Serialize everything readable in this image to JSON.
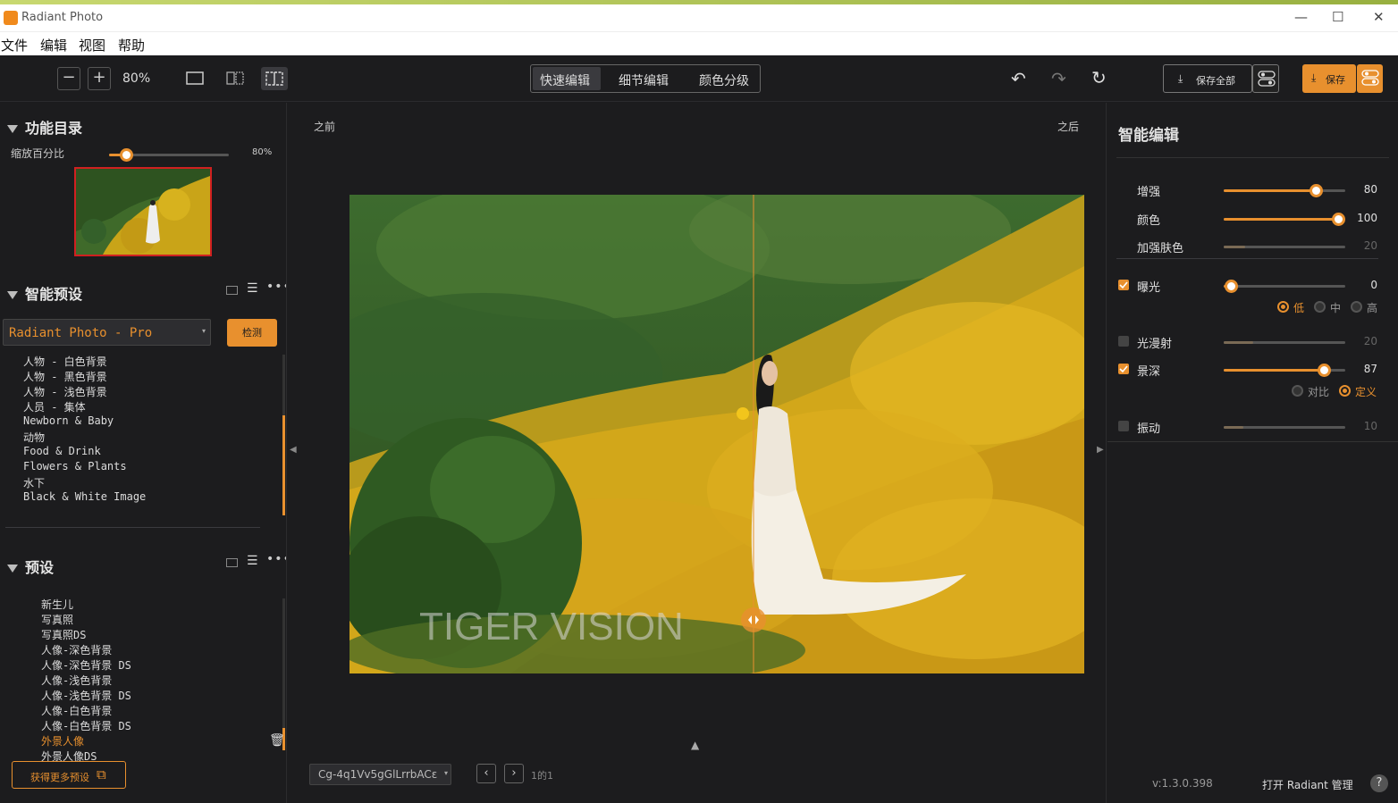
{
  "window": {
    "title": "Radiant Photo",
    "minimize": "—",
    "maximize": "☐",
    "close": "✕"
  },
  "menu": [
    "文件",
    "编辑",
    "视图",
    "帮助"
  ],
  "toolbar": {
    "zoom_out": "−",
    "zoom_in": "+",
    "zoom": "80%",
    "modes": [
      "快速编辑",
      "细节编辑",
      "颜色分级"
    ],
    "save_all": "保存全部",
    "save": "保存"
  },
  "left": {
    "catalog_title": "功能目录",
    "zoom_label": "缩放百分比",
    "zoom_value": "80%",
    "zoom_fraction": 0.14,
    "smart_presets_title": "智能预设",
    "preset_select": "Radiant Photo - Pro",
    "detect_label": "检测",
    "smart_presets": [
      "人物 - 白色背景",
      "人物 - 黑色背景",
      "人物 - 浅色背景",
      "人员 - 集体",
      "Newborn & Baby",
      "动物",
      "Food & Drink",
      "Flowers & Plants",
      "水下",
      "Black & White Image"
    ],
    "presets_title": "预设",
    "presets": [
      "新生儿",
      "写真照",
      "写真照DS",
      "人像-深色背景",
      "人像-深色背景 DS",
      "人像-浅色背景",
      "人像-浅色背景 DS",
      "人像-白色背景",
      "人像-白色背景 DS",
      "外景人像",
      "外景人像DS"
    ],
    "active_preset": "外景人像",
    "more_presets": "获得更多预设"
  },
  "center": {
    "before": "之前",
    "after": "之后",
    "watermark": "TIGER VISION",
    "file_select": "Cg-4q1Vv5gGlLrrbACε",
    "page": "1的1"
  },
  "right": {
    "title": "智能编辑",
    "sliders": [
      {
        "label": "增强",
        "value": "80",
        "fraction": 0.76,
        "checkbox": null,
        "enabled": true
      },
      {
        "label": "颜色",
        "value": "100",
        "fraction": 0.94,
        "checkbox": null,
        "enabled": true
      },
      {
        "label": "加强肤色",
        "value": "20",
        "fraction": 0.18,
        "checkbox": null,
        "enabled": false
      },
      {
        "label": "曝光",
        "value": "0",
        "fraction": 0.06,
        "checkbox": true,
        "enabled": true
      },
      {
        "label": "光漫射",
        "value": "20",
        "fraction": 0.24,
        "checkbox": false,
        "enabled": false
      },
      {
        "label": "景深",
        "value": "87",
        "fraction": 0.82,
        "checkbox": true,
        "enabled": true
      },
      {
        "label": "振动",
        "value": "10",
        "fraction": 0.16,
        "checkbox": false,
        "enabled": false
      }
    ],
    "exposure_levels": [
      "低",
      "中",
      "高"
    ],
    "exposure_selected": "低",
    "dof_modes": [
      "对比",
      "定义"
    ],
    "dof_selected": "定义",
    "version": "v:1.3.0.398",
    "open_manager": "打开 Radiant 管理",
    "help": "?"
  },
  "colors": {
    "accent": "#e8902e",
    "bg": "#1c1c1e"
  }
}
